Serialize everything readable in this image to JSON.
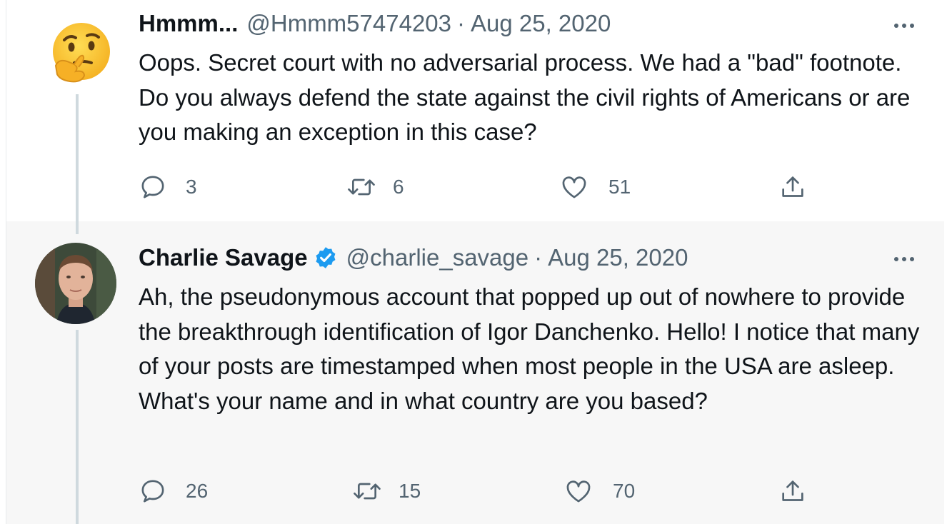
{
  "tweets": [
    {
      "author_name": "Hmmm...",
      "handle": "@Hmmm57474203",
      "separator": "·",
      "date": "Aug 25, 2020",
      "avatar": "thinking-face-emoji",
      "verified": false,
      "text": "Oops.  Secret court with no adversarial process.  We had a \"bad\" footnote.  Do you always defend the state against the civil rights of Americans or are you making an exception in this case?",
      "reply_count": "3",
      "retweet_count": "6",
      "like_count": "51"
    },
    {
      "author_name": "Charlie Savage",
      "handle": "@charlie_savage",
      "separator": "·",
      "date": "Aug 25, 2020",
      "avatar": "profile-photo",
      "verified": true,
      "text": "Ah, the pseudonymous account that popped up out of nowhere to provide the breakthrough identification of Igor Danchenko. Hello! I notice that many of your posts are timestamped when most people in the USA are asleep. What's your name and in what country are you based?",
      "reply_count": "26",
      "retweet_count": "15",
      "like_count": "70"
    }
  ],
  "icons": {
    "reply": "speech-bubble-icon",
    "retweet": "retweet-arrows-icon",
    "like": "heart-icon",
    "share": "share-upload-icon",
    "more": "ellipsis-icon",
    "verified": "verified-badge-icon"
  },
  "colors": {
    "text": "#0f1419",
    "secondary": "#536471",
    "verified_blue": "#1d9bf0",
    "thread_line": "#cfd9de",
    "highlight_bg": "#f7f7f7"
  }
}
